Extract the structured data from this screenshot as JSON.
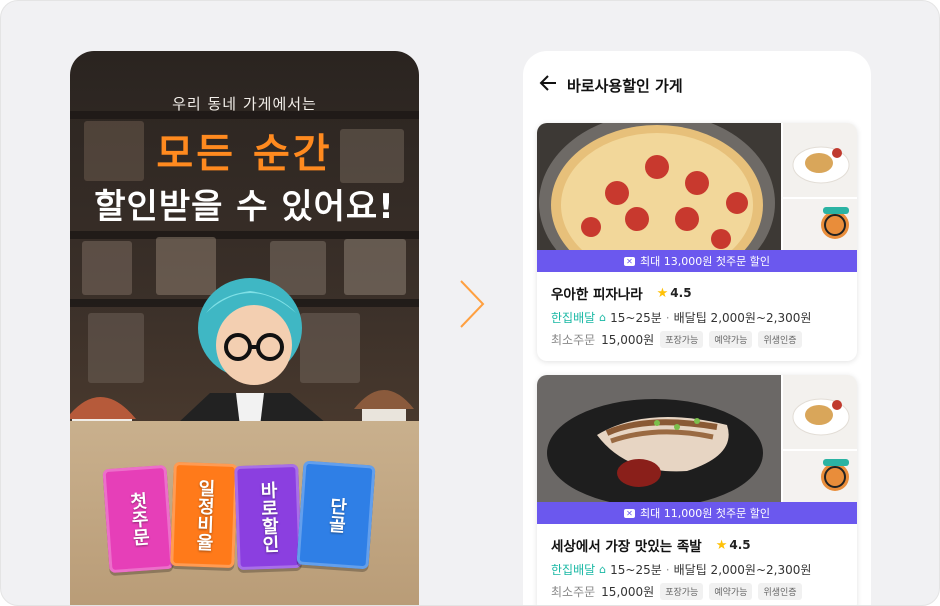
{
  "promo": {
    "subtitle": "우리 동네 가게에서는",
    "title_line1": "모든 순간",
    "title_line2": "할인받을 수 있어요!",
    "tickets": [
      {
        "label": "첫주문",
        "color": "#e63fb8"
      },
      {
        "label": "일정비율",
        "color": "#ff7a1a"
      },
      {
        "label": "바로할인",
        "color": "#8b3fe0"
      },
      {
        "label": "단골",
        "color": "#2f7fe6"
      }
    ]
  },
  "header": {
    "title": "바로사용할인 가게"
  },
  "stores": [
    {
      "discount": "최대 13,000원 첫주문 할인",
      "name": "우아한 피자나라",
      "rating": "4.5",
      "delivery_type": "한집배달",
      "time": "15~25분",
      "tip": "배달팁 2,000원~2,300원",
      "min_label": "최소주문",
      "min_value": "15,000원",
      "tags": [
        "포장가능",
        "예약가능",
        "위생인증"
      ]
    },
    {
      "discount": "최대 11,000원 첫주문 할인",
      "name": "세상에서 가장 맛있는 족발",
      "rating": "4.5",
      "delivery_type": "한집배달",
      "time": "15~25분",
      "tip": "배달팁 2,000원~2,300원",
      "min_label": "최소주문",
      "min_value": "15,000원",
      "tags": [
        "포장가능",
        "예약가능",
        "위생인증"
      ]
    }
  ],
  "colors": {
    "accent_orange": "#ff8a1f",
    "discount_bar": "#6b58ee",
    "delivery_teal": "#19b8a4",
    "star": "#ffc107"
  },
  "icons": [
    "back-arrow-icon",
    "chevron-right-icon",
    "star-icon",
    "home-icon",
    "coupon-icon"
  ]
}
